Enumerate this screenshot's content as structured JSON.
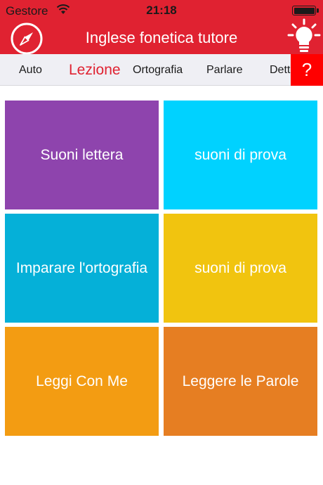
{
  "status_bar": {
    "carrier": "Gestore",
    "time": "21:18"
  },
  "header": {
    "title": "Inglese fonetica tutore"
  },
  "tabs": [
    {
      "label": "Auto"
    },
    {
      "label": "Lezione",
      "active": true
    },
    {
      "label": "Ortografia"
    },
    {
      "label": "Parlare"
    },
    {
      "label": "Dett"
    }
  ],
  "help": {
    "label": "?"
  },
  "tiles": [
    {
      "label": "Suoni lettera",
      "color": "#8e44ad"
    },
    {
      "label": "suoni di prova",
      "color": "#00d2ff"
    },
    {
      "label": "Imparare l'ortografia",
      "color": "#05b0d8"
    },
    {
      "label": "suoni di prova",
      "color": "#f1c40f"
    },
    {
      "label": "Leggi Con Me",
      "color": "#f39c12"
    },
    {
      "label": "Leggere le Parole",
      "color": "#e67e22"
    }
  ],
  "colors": {
    "header": "#e02231",
    "help_button": "#ff0000",
    "active_tab": "#e02231"
  },
  "icons": {
    "left_header": "compass-icon",
    "right_header": "lightbulb-icon",
    "wifi": "wifi-icon",
    "battery": "battery-icon"
  }
}
